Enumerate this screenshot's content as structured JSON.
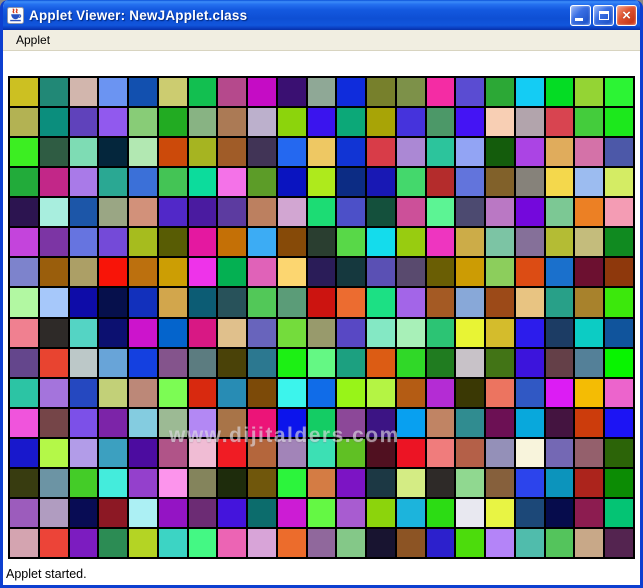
{
  "window": {
    "title": "Applet Viewer: NewJApplet.class",
    "controls": {
      "minimize": "minimize",
      "maximize": "maximize",
      "close": "close",
      "close_glyph": "×"
    }
  },
  "menubar": {
    "items": [
      {
        "label": "Applet"
      }
    ]
  },
  "applet": {
    "watermark": "www.dijitalders.com",
    "grid": {
      "rows": 16,
      "cols": 21,
      "line_color": "#000000",
      "colors": [
        [
          "#ccc022",
          "#218876",
          "#d2b6ad",
          "#6b94f2",
          "#1250af",
          "#cccc70",
          "#12bf50",
          "#b5498c",
          "#c50cc5",
          "#3a1072",
          "#8fa896",
          "#0f2cdc",
          "#77802c",
          "#7d9149",
          "#f42ca4",
          "#5a4cd2",
          "#2ca836",
          "#14ccf4",
          "#04dc24",
          "#94d434",
          "#2cf434"
        ],
        [
          "#b3b253",
          "#0b8e7d",
          "#5f42bb",
          "#9159ee",
          "#88cc77",
          "#22ab22",
          "#88b383",
          "#ab7a55",
          "#bcb0cc",
          "#8cd40c",
          "#3a14ee",
          "#0ca878",
          "#a8a406",
          "#4533dc",
          "#4c9868",
          "#4414f4",
          "#f8cfb4",
          "#b2a4ac",
          "#d84450",
          "#44cc3c",
          "#1ce81c"
        ],
        [
          "#3cee22",
          "#2f5c43",
          "#7edcb4",
          "#04263c",
          "#b2e8b2",
          "#cc4a0a",
          "#a6b421",
          "#a05c28",
          "#413456",
          "#2468f0",
          "#eec863",
          "#1134d4",
          "#d83c48",
          "#ab88d4",
          "#2cc49c",
          "#92a4f4",
          "#145c0c",
          "#ab44e4",
          "#e0ac5c",
          "#d472a8",
          "#4c58a8"
        ],
        [
          "#22ab3a",
          "#c22788",
          "#a97ae8",
          "#2aa893",
          "#3b70d8",
          "#44c455",
          "#0cdc9c",
          "#f472e8",
          "#5c9c28",
          "#0a14c0",
          "#aeea1c",
          "#0c2c84",
          "#1818b4",
          "#44d86c",
          "#b42c2c",
          "#6274dc",
          "#81612a",
          "#86827a",
          "#f4d84c",
          "#9cbcf0",
          "#d4ec64"
        ],
        [
          "#2c1450",
          "#a8eede",
          "#1c56a8",
          "#9aa684",
          "#d2917a",
          "#5128c8",
          "#4a1ba0",
          "#5c3ba0",
          "#bc8060",
          "#d2a6d2",
          "#1cdc74",
          "#4c50c8",
          "#14503c",
          "#cc5099",
          "#5cf494",
          "#4c4a70",
          "#ba78c4",
          "#7408dc",
          "#7cc894",
          "#ec8024",
          "#f49cb4"
        ],
        [
          "#c444dc",
          "#7c35a4",
          "#6674e0",
          "#744ad8",
          "#a6bc1e",
          "#585c04",
          "#e418a0",
          "#c47006",
          "#3cacf4",
          "#864a08",
          "#2a3e30",
          "#58d848",
          "#14dcec",
          "#98cc10",
          "#ee35c0",
          "#ccac48",
          "#7cc4a4",
          "#857099",
          "#b4bc34",
          "#c4bc7c",
          "#108a20"
        ],
        [
          "#7d83cc",
          "#9a5e0c",
          "#ac9f66",
          "#f81408",
          "#bc700e",
          "#cc9e04",
          "#ee33ea",
          "#04b052",
          "#e062b8",
          "#fcd670",
          "#2a1c58",
          "#15383e",
          "#5a50b4",
          "#594a6e",
          "#6a5e04",
          "#cc9c04",
          "#8cce5c",
          "#dc4c14",
          "#1a70cc",
          "#6c1030",
          "#8e380c"
        ],
        [
          "#b2f8a2",
          "#a6c8fa",
          "#0e0ca8",
          "#06104c",
          "#1230bc",
          "#d2a64c",
          "#0c5c74",
          "#28525a",
          "#52c858",
          "#5b9c78",
          "#cc1410",
          "#ec6c30",
          "#1ce084",
          "#a365e8",
          "#a45a24",
          "#88a8d8",
          "#9c4a18",
          "#e8c482",
          "#28a088",
          "#a8822c",
          "#3ce80c"
        ],
        [
          "#f08090",
          "#2e2a28",
          "#54d4c4",
          "#0c1070",
          "#cc14cc",
          "#0464cc",
          "#d81884",
          "#e0c08c",
          "#6864bc",
          "#74dc3c",
          "#989a6c",
          "#5848c4",
          "#84e8c4",
          "#a8f0b8",
          "#2cc474",
          "#e8f434",
          "#d4bc2c",
          "#2c1cec",
          "#1c3c64",
          "#0cccc4",
          "#10549c"
        ],
        [
          "#64468c",
          "#e84430",
          "#bcc8c8",
          "#68a4d8",
          "#1440e0",
          "#84548c",
          "#5c7c80",
          "#4a4208",
          "#2c7890",
          "#1cf014",
          "#64f884",
          "#1ca080",
          "#dc5c14",
          "#30d828",
          "#207c20",
          "#c8c2c8",
          "#427416",
          "#3c14dc",
          "#644048",
          "#548098",
          "#08f400"
        ],
        [
          "#2cc4a4",
          "#a474dc",
          "#2548c0",
          "#c2d078",
          "#bc8878",
          "#7cfc54",
          "#d8290f",
          "#288cb4",
          "#7c4a08",
          "#3cf4ec",
          "#106ce8",
          "#98f418",
          "#b4f444",
          "#b45c14",
          "#b42cd4",
          "#3a3804",
          "#ec7460",
          "#3058c4",
          "#dc1cf4",
          "#f4bc04",
          "#ec64cc"
        ],
        [
          "#f054dc",
          "#754548",
          "#7c50e8",
          "#7c24a8",
          "#84cce0",
          "#9cba94",
          "#b388f4",
          "#a87448",
          "#ec1478",
          "#0c14ec",
          "#14cc64",
          "#8c4898",
          "#3c1484",
          "#08a0f0",
          "#c08464",
          "#308c90",
          "#6c1054",
          "#08a8dc",
          "#441440",
          "#cc3c0c",
          "#1c14f4"
        ],
        [
          "#1818cc",
          "#b4f848",
          "#b29ce8",
          "#3ca0c0",
          "#4c0ca0",
          "#b05488",
          "#f0bcd4",
          "#f01c24",
          "#b4663c",
          "#a284b8",
          "#3ce0b4",
          "#60c024",
          "#501020",
          "#ec1424",
          "#f07c7c",
          "#b46048",
          "#9490b8",
          "#f8f4dc",
          "#7468b4",
          "#94606c",
          "#2c6408"
        ],
        [
          "#383c10",
          "#6c94a4",
          "#44cc28",
          "#44ecdc",
          "#9440cc",
          "#fc94ec",
          "#84845c",
          "#1e2c0c",
          "#70570c",
          "#2cf43c",
          "#d47c44",
          "#7c14c4",
          "#1c3844",
          "#d4ec84",
          "#2e2a28",
          "#90d890",
          "#86603c",
          "#2c44ec",
          "#0c94bc",
          "#ac241c",
          "#0c8c04"
        ],
        [
          "#9c5cbc",
          "#b09cc0",
          "#080c54",
          "#8c1824",
          "#acf0f4",
          "#9414c4",
          "#6c2c74",
          "#4414dc",
          "#0c6c6c",
          "#cc1cd4",
          "#64f844",
          "#a85cd0",
          "#8cd40c",
          "#1cb4dc",
          "#2cdc14",
          "#e8e8f0",
          "#e8f444",
          "#1c4878",
          "#060c4c",
          "#8c1c50",
          "#04c474"
        ],
        [
          "#d4a4b0",
          "#ec4438",
          "#7c1cc0",
          "#2c8c54",
          "#b4d424",
          "#3cd4c4",
          "#44f884",
          "#ec64b4",
          "#d8a4d8",
          "#ec6c2c",
          "#90689c",
          "#84c888",
          "#181430",
          "#8c5424",
          "#2c20cc",
          "#4cdc0c",
          "#b484f8",
          "#50bcac",
          "#54c45c",
          "#c8a888",
          "#542450"
        ]
      ]
    }
  },
  "statusbar": {
    "text": "Applet started."
  }
}
